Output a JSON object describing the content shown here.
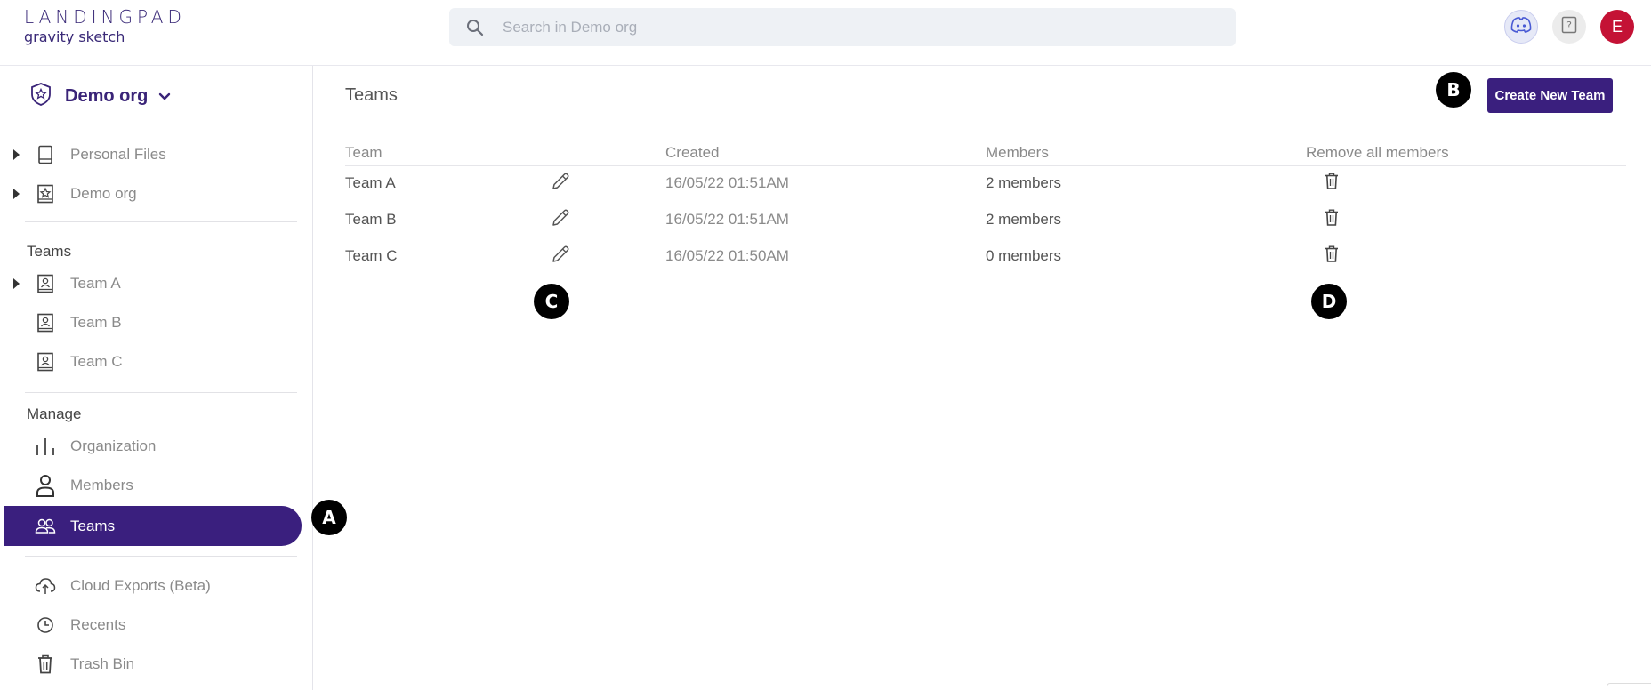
{
  "logo": {
    "main": "LANDINGPAD",
    "sub": "gravity sketch"
  },
  "search": {
    "placeholder": "Search in Demo org"
  },
  "topbar": {
    "avatar_initial": "E",
    "discord_icon": "discord-icon",
    "help_icon": "help-icon"
  },
  "sidebar": {
    "org_name": "Demo org",
    "files": [
      {
        "label": "Personal Files",
        "icon": "tablet-icon"
      },
      {
        "label": "Demo org",
        "icon": "org-star-icon"
      }
    ],
    "teams_heading": "Teams",
    "teams": [
      {
        "label": "Team A",
        "icon": "team-badge-icon"
      },
      {
        "label": "Team B",
        "icon": "team-badge-icon"
      },
      {
        "label": "Team C",
        "icon": "team-badge-icon"
      }
    ],
    "manage_heading": "Manage",
    "manage": [
      {
        "label": "Organization",
        "icon": "organization-icon"
      },
      {
        "label": "Members",
        "icon": "person-icon"
      },
      {
        "label": "Teams",
        "icon": "people-icon"
      }
    ],
    "other": [
      {
        "label": "Cloud Exports (Beta)",
        "icon": "cloud-upload-icon"
      },
      {
        "label": "Recents",
        "icon": "clock-icon"
      },
      {
        "label": "Trash Bin",
        "icon": "trash-icon"
      }
    ]
  },
  "main": {
    "title": "Teams",
    "create_button": "Create New Team",
    "columns": {
      "team": "Team",
      "created": "Created",
      "members": "Members",
      "remove": "Remove all members"
    },
    "rows": [
      {
        "name": "Team A",
        "created": "16/05/22 01:51AM",
        "members": "2 members"
      },
      {
        "name": "Team B",
        "created": "16/05/22 01:51AM",
        "members": "2 members"
      },
      {
        "name": "Team C",
        "created": "16/05/22 01:50AM",
        "members": "0 members"
      }
    ]
  },
  "markers": {
    "a": "A",
    "b": "B",
    "c": "C",
    "d": "D"
  },
  "colors": {
    "brand": "#3a1f7e",
    "avatar": "#c41235",
    "search_bg": "#eef1f5"
  }
}
